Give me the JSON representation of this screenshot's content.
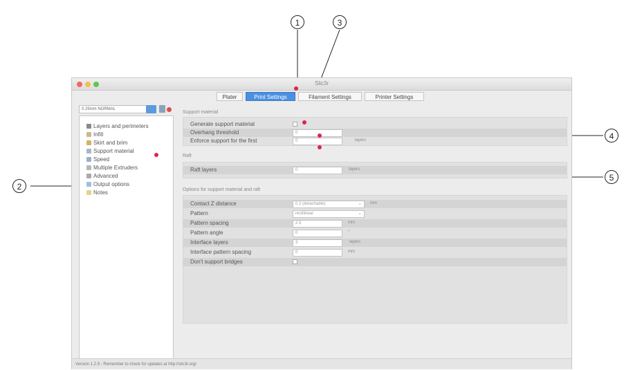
{
  "callouts": [
    "1",
    "2",
    "3",
    "4",
    "5"
  ],
  "window": {
    "title": "Slic3r"
  },
  "tabs": [
    "Plater",
    "Print Settings",
    "Filament Settings",
    "Printer Settings"
  ],
  "preset": {
    "value": "0.25mm NORMAL"
  },
  "sidebar": {
    "items": [
      {
        "label": "Layers and perimeters",
        "icon": "layers-icon",
        "color": "#8a8a8a"
      },
      {
        "label": "Infill",
        "icon": "infill-icon",
        "color": "#c9b98a"
      },
      {
        "label": "Skirt and brim",
        "icon": "skirt-icon",
        "color": "#d6b160"
      },
      {
        "label": "Support material",
        "icon": "support-icon",
        "color": "#a6b8cf"
      },
      {
        "label": "Speed",
        "icon": "speed-icon",
        "color": "#9ab0c7"
      },
      {
        "label": "Multiple Extruders",
        "icon": "extruder-icon",
        "color": "#b7b7b7"
      },
      {
        "label": "Advanced",
        "icon": "wrench-icon",
        "color": "#aaaaaa"
      },
      {
        "label": "Output options",
        "icon": "output-icon",
        "color": "#9cc0e0"
      },
      {
        "label": "Notes",
        "icon": "notes-icon",
        "color": "#e4d48a"
      }
    ]
  },
  "support_material": {
    "title": "Support material",
    "rows": [
      {
        "label": "Generate support material",
        "value": ""
      },
      {
        "label": "Overhang threshold",
        "value": "0"
      },
      {
        "label": "Enforce support for the first",
        "value": "0",
        "unit": "layers"
      }
    ]
  },
  "raft": {
    "title": "Raft",
    "rows": [
      {
        "label": "Raft layers",
        "value": "0",
        "unit": "layers"
      }
    ]
  },
  "options": {
    "title": "Options for support material and raft",
    "rows": [
      {
        "label": "Contact Z distance",
        "value": "0.2 (detachable)",
        "unit": "mm"
      },
      {
        "label": "Pattern",
        "value": "rectilinear"
      },
      {
        "label": "Pattern spacing",
        "value": "2.5",
        "unit": "mm"
      },
      {
        "label": "Pattern angle",
        "value": "0",
        "unit": "°"
      },
      {
        "label": "Interface layers",
        "value": "3",
        "unit": "layers"
      },
      {
        "label": "Interface pattern spacing",
        "value": "0",
        "unit": "mm"
      },
      {
        "label": "Don't support bridges",
        "value": ""
      }
    ]
  },
  "status": "Version 1.2.9 - Remember to check for updates at http://slic3r.org/",
  "colors": {
    "accent": "#4a90e2",
    "marker": "#e0224b"
  }
}
